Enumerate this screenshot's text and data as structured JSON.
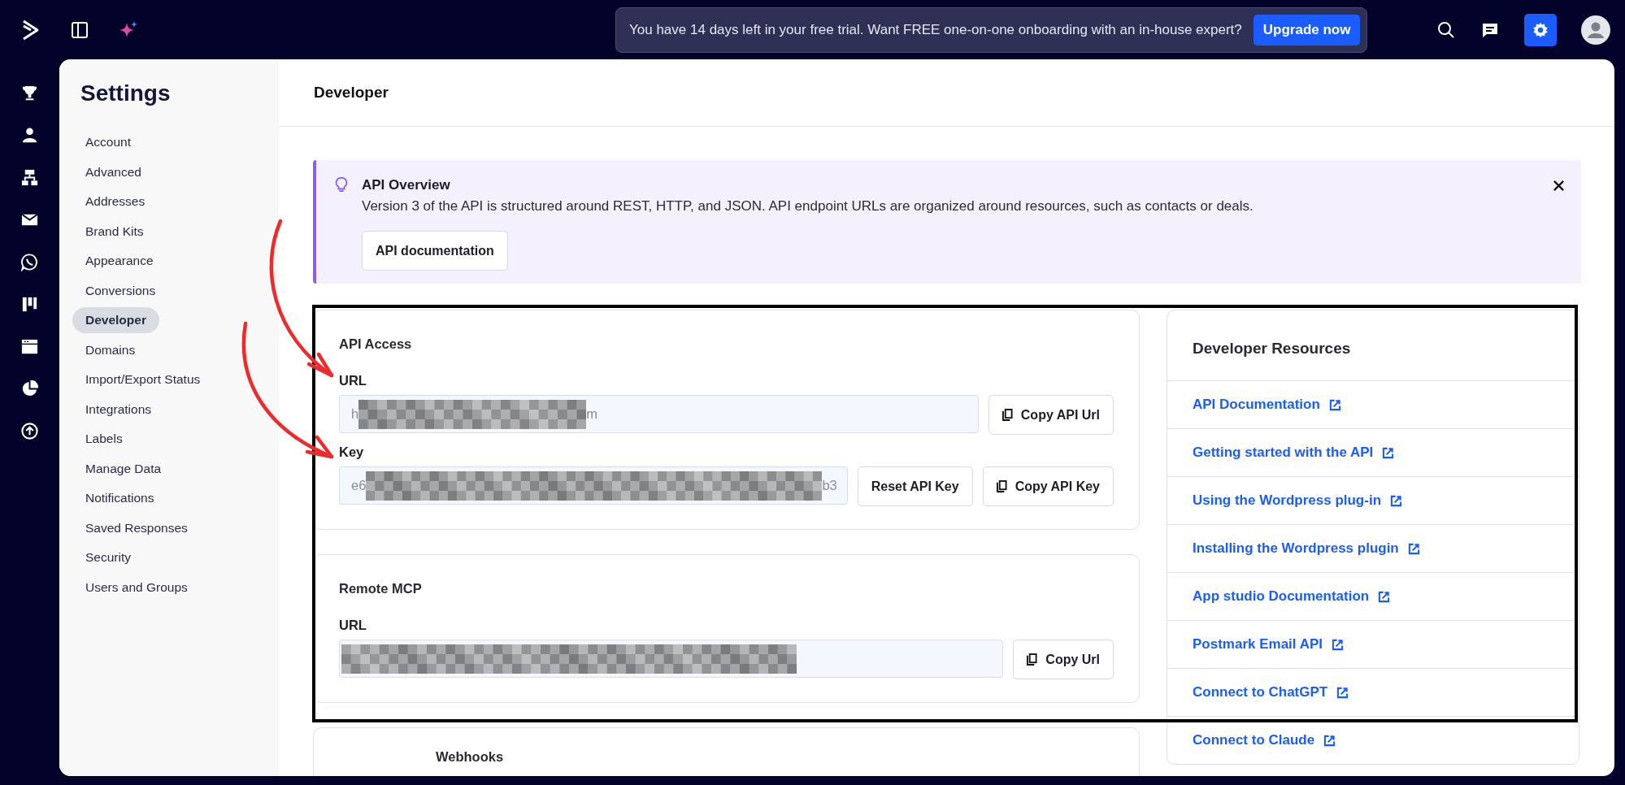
{
  "top_bar": {
    "trial_banner": {
      "text": "You have 14 days left in your free trial. Want FREE one-on-one onboarding with an in-house expert?",
      "button": "Upgrade now"
    },
    "settings_active": true
  },
  "rail": [
    {
      "kind": "trophy"
    },
    {
      "kind": "person"
    },
    {
      "kind": "sitemap"
    },
    {
      "kind": "mail"
    },
    {
      "kind": "chat"
    },
    {
      "kind": "kanban"
    },
    {
      "kind": "window"
    },
    {
      "kind": "pie"
    },
    {
      "kind": "upload"
    }
  ],
  "sidebar": {
    "title": "Settings",
    "items": [
      {
        "label": "Account",
        "selected": false
      },
      {
        "label": "Advanced",
        "selected": false
      },
      {
        "label": "Addresses",
        "selected": false
      },
      {
        "label": "Brand Kits",
        "selected": false
      },
      {
        "label": "Appearance",
        "selected": false
      },
      {
        "label": "Conversions",
        "selected": false
      },
      {
        "label": "Developer",
        "selected": true
      },
      {
        "label": "Domains",
        "selected": false
      },
      {
        "label": "Import/Export Status",
        "selected": false
      },
      {
        "label": "Integrations",
        "selected": false
      },
      {
        "label": "Labels",
        "selected": false
      },
      {
        "label": "Manage Data",
        "selected": false
      },
      {
        "label": "Notifications",
        "selected": false
      },
      {
        "label": "Saved Responses",
        "selected": false
      },
      {
        "label": "Security",
        "selected": false
      },
      {
        "label": "Users and Groups",
        "selected": false
      }
    ]
  },
  "page": {
    "title": "Developer"
  },
  "alert": {
    "title": "API Overview",
    "text": "Version 3 of the API is structured around REST, HTTP, and JSON. API endpoint URLs are organized around resources, such as contacts or deals.",
    "button": "API documentation"
  },
  "api_access": {
    "title": "API Access",
    "fields": [
      {
        "label": "URL",
        "prefix": "h",
        "suffix": "m",
        "buttons": [
          "Copy API Url"
        ]
      },
      {
        "label": "Key",
        "prefix": "e6",
        "suffix": "b3",
        "buttons": [
          "Reset API Key",
          "Copy API Key"
        ]
      }
    ]
  },
  "remote_mcp": {
    "title": "Remote MCP",
    "fields": [
      {
        "label": "URL",
        "buttons": [
          "Copy Url"
        ]
      }
    ]
  },
  "webhooks": {
    "title": "Webhooks"
  },
  "resources": {
    "title": "Developer Resources",
    "links": [
      "API Documentation",
      "Getting started with the API",
      "Using the Wordpress plug-in",
      "Installing the Wordpress plugin",
      "App studio Documentation",
      "Postmark Email API",
      "Connect to ChatGPT",
      "Connect to Claude"
    ]
  },
  "annotations": [
    {
      "kind": "frame"
    },
    {
      "kind": "arrow"
    },
    {
      "kind": "arrow"
    }
  ]
}
